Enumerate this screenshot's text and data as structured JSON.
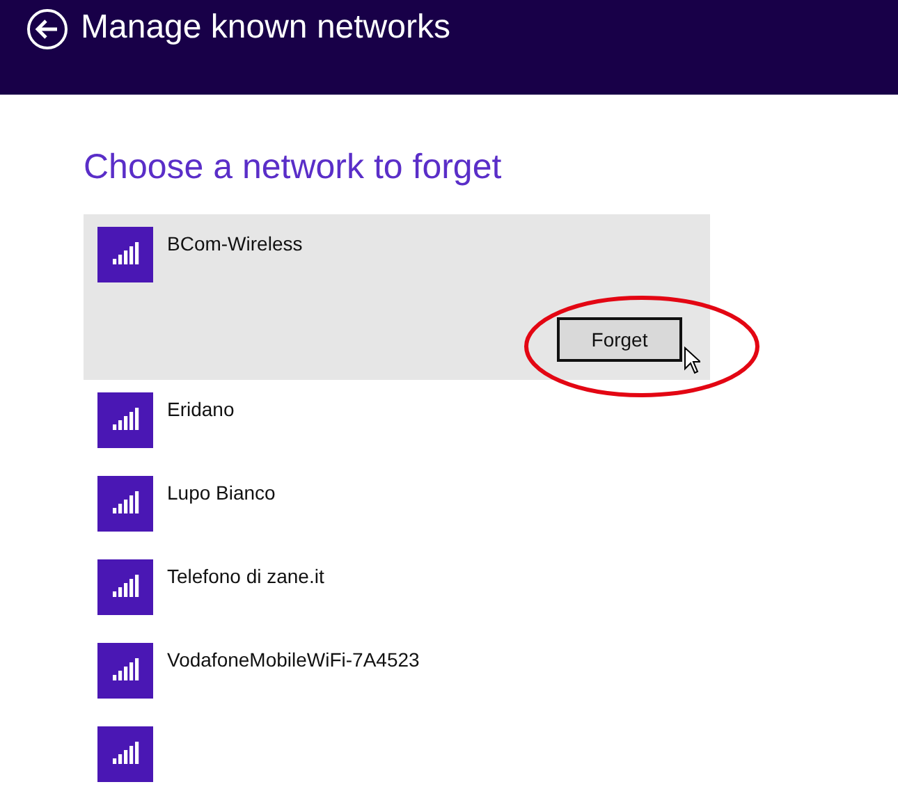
{
  "header": {
    "title": "Manage known networks"
  },
  "heading": "Choose a network to forget",
  "networks": [
    {
      "name": "BCom-Wireless",
      "selected": true,
      "action": "Forget"
    },
    {
      "name": "Eridano",
      "selected": false
    },
    {
      "name": "Lupo Bianco",
      "selected": false
    },
    {
      "name": "Telefono di zane.it",
      "selected": false
    },
    {
      "name": "VodafoneMobileWiFi-7A4523",
      "selected": false
    },
    {
      "selected": false
    }
  ]
}
